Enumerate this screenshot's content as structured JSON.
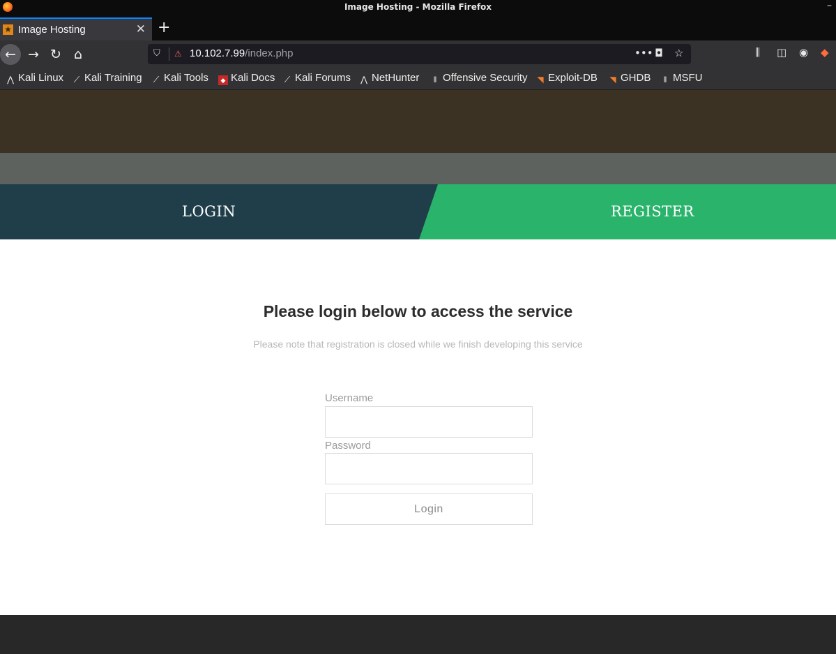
{
  "window": {
    "title": "Image Hosting - Mozilla Firefox"
  },
  "browser": {
    "tab": {
      "title": "Image Hosting"
    },
    "url": {
      "host": "10.102.7.99",
      "path": "/index.php"
    },
    "bookmarks": [
      {
        "label": "Kali Linux",
        "icon": "kali-dragon-icon"
      },
      {
        "label": "Kali Training",
        "icon": "kali-dragon-icon"
      },
      {
        "label": "Kali Tools",
        "icon": "kali-dragon-icon"
      },
      {
        "label": "Kali Docs",
        "icon": "kali-docs-icon"
      },
      {
        "label": "Kali Forums",
        "icon": "kali-dragon-icon"
      },
      {
        "label": "NetHunter",
        "icon": "kali-dragon-icon"
      },
      {
        "label": "Offensive Security",
        "icon": "offsec-icon"
      },
      {
        "label": "Exploit-DB",
        "icon": "exploit-db-icon"
      },
      {
        "label": "GHDB",
        "icon": "exploit-db-icon"
      },
      {
        "label": "MSFU",
        "icon": "offsec-icon"
      }
    ]
  },
  "page": {
    "auth_tabs": {
      "login": "LOGIN",
      "register": "REGISTER"
    },
    "heading": "Please login below to access the service",
    "note": "Please note that registration is closed while we finish developing this service",
    "form": {
      "username_label": "Username",
      "username_value": "",
      "password_label": "Password",
      "password_value": "",
      "submit_label": "Login"
    }
  },
  "colors": {
    "hero": "#3b3224",
    "login_tab": "#203e4a",
    "register_tab": "#2ab36b",
    "footer": "#282828"
  }
}
